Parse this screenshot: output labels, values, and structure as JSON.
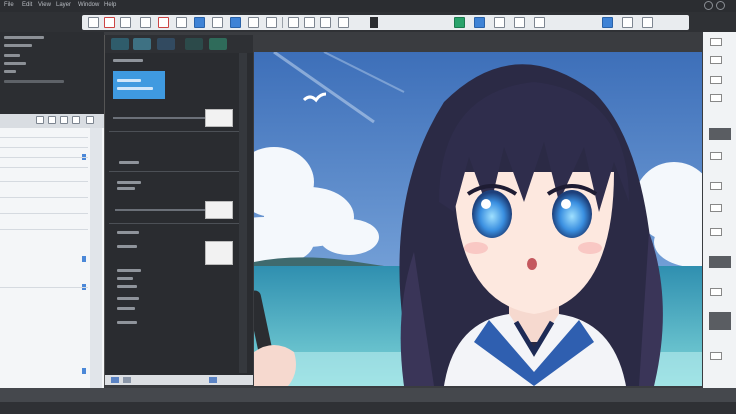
{
  "menu": {
    "items": [
      "File",
      "Edit",
      "View",
      "Layer",
      "Window",
      "Help"
    ]
  },
  "toolbar": {
    "buttons": [
      "new-icon",
      "open-icon",
      "save-icon",
      "undo-icon",
      "redo-icon",
      "brush-icon",
      "eraser-icon",
      "fill-icon",
      "select-icon",
      "move-icon",
      "zoom-icon",
      "hand-icon",
      "rotate-icon",
      "flip-icon"
    ],
    "accent": "#3f83d6"
  },
  "canvas": {
    "subject": "artwork-canvas"
  },
  "colors": {
    "sky": "#5d8fcf",
    "sea": "#4fb6c6",
    "hair": "#2b2a45",
    "eye": "#3a8fe0",
    "collar": "#2f5fb0"
  }
}
